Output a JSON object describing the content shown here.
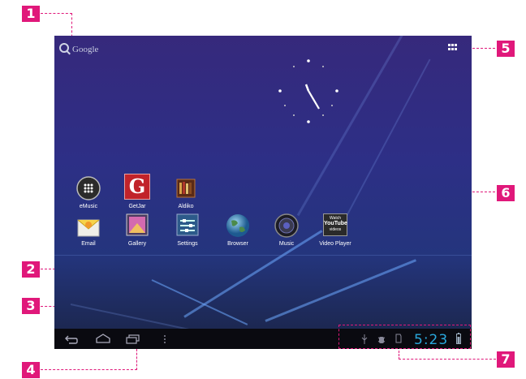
{
  "callouts": [
    "1",
    "2",
    "3",
    "4",
    "5",
    "6",
    "7"
  ],
  "search": {
    "label": "Google",
    "icon": "search-icon"
  },
  "apps_button": {
    "icon": "all-apps-grid-icon"
  },
  "clock": {
    "icon": "analog-clock-widget"
  },
  "apps_row1": [
    {
      "label": "eMusic",
      "icon": "emusic-icon"
    },
    {
      "label": "GetJar",
      "icon": "getjar-icon"
    },
    {
      "label": "Aldiko",
      "icon": "aldiko-icon"
    }
  ],
  "apps_row2": [
    {
      "label": "Email",
      "icon": "email-icon"
    },
    {
      "label": "Gallery",
      "icon": "gallery-icon"
    },
    {
      "label": "Settings",
      "icon": "settings-icon"
    },
    {
      "label": "Browser",
      "icon": "browser-globe-icon"
    },
    {
      "label": "Music",
      "icon": "music-speaker-icon"
    },
    {
      "label": "Video Player",
      "icon": "youtube-video-icon"
    }
  ],
  "youtube_icon_text": {
    "top": "Watch",
    "brand": "YouTube",
    "bottom": "videos"
  },
  "getjar_letter": "G",
  "nav": {
    "back": "back-icon",
    "home": "home-icon",
    "recent": "recent-apps-icon",
    "menu": "menu-icon"
  },
  "status": {
    "time": "5:23",
    "icons": [
      "usb-icon",
      "debug-icon",
      "sd-card-icon",
      "battery-icon"
    ]
  },
  "colors": {
    "callout": "#e0187a",
    "clock_text": "#2aa8dd",
    "navbar": "#0a0a10"
  }
}
